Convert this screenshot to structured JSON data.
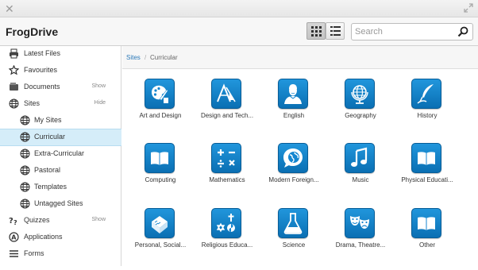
{
  "app": {
    "title": "FrogDrive"
  },
  "search": {
    "placeholder": "Search"
  },
  "sidebar": {
    "items": [
      {
        "label": "Latest Files",
        "icon": "printer-icon",
        "action": ""
      },
      {
        "label": "Favourites",
        "icon": "star-icon",
        "action": ""
      },
      {
        "label": "Documents",
        "icon": "document-icon",
        "action": "Show"
      },
      {
        "label": "Sites",
        "icon": "globe-icon",
        "action": "Hide"
      },
      {
        "label": "My Sites",
        "icon": "globe-icon",
        "action": ""
      },
      {
        "label": "Curricular",
        "icon": "globe-icon",
        "action": "",
        "selected": true
      },
      {
        "label": "Extra-Curricular",
        "icon": "globe-icon",
        "action": ""
      },
      {
        "label": "Pastoral",
        "icon": "globe-icon",
        "action": ""
      },
      {
        "label": "Templates",
        "icon": "globe-icon",
        "action": ""
      },
      {
        "label": "Untagged Sites",
        "icon": "globe-icon",
        "action": ""
      },
      {
        "label": "Quizzes",
        "icon": "quiz-icon",
        "action": "Show"
      },
      {
        "label": "Applications",
        "icon": "applications-icon",
        "action": ""
      },
      {
        "label": "Forms",
        "icon": "forms-icon",
        "action": ""
      }
    ]
  },
  "breadcrumb": {
    "root": "Sites",
    "separator": "/",
    "current": "Curricular"
  },
  "sites": [
    {
      "label": "Art and Design",
      "icon": "palette-icon"
    },
    {
      "label": "Design and Tech...",
      "icon": "compass-icon"
    },
    {
      "label": "English",
      "icon": "shakespeare-icon"
    },
    {
      "label": "Geography",
      "icon": "globe-stand-icon"
    },
    {
      "label": "History",
      "icon": "quill-icon"
    },
    {
      "label": "Computing",
      "icon": "book-icon"
    },
    {
      "label": "Mathematics",
      "icon": "math-symbols-icon"
    },
    {
      "label": "Modern Foreign...",
      "icon": "speech-globe-icon"
    },
    {
      "label": "Music",
      "icon": "music-note-icon"
    },
    {
      "label": "Physical Educati...",
      "icon": "book-icon"
    },
    {
      "label": "Personal, Social...",
      "icon": "cube-icon"
    },
    {
      "label": "Religious Educa...",
      "icon": "religious-symbols-icon"
    },
    {
      "label": "Science",
      "icon": "flask-icon"
    },
    {
      "label": "Drama, Theatre...",
      "icon": "theatre-masks-icon"
    },
    {
      "label": "Other",
      "icon": "book-icon"
    }
  ],
  "colors": {
    "tile": "#1486d0",
    "selected": "#d5edf9",
    "link": "#2a78b8"
  }
}
